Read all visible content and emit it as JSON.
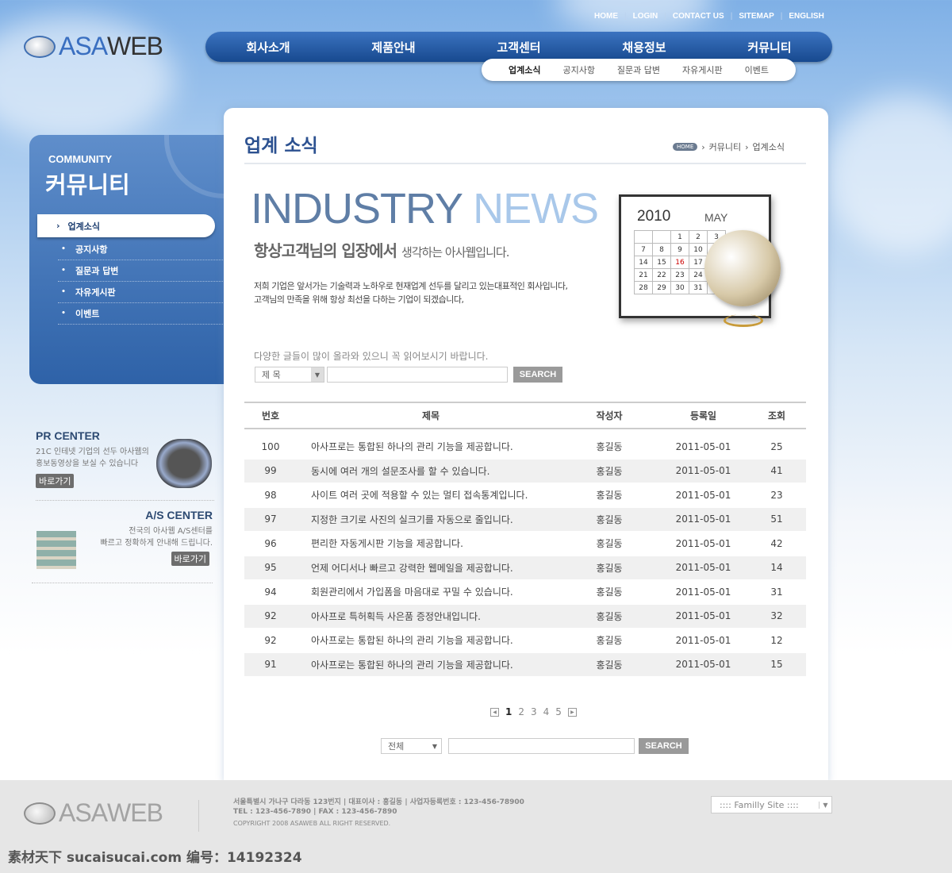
{
  "topnav": [
    "HOME",
    "LOGIN",
    "CONTACT US",
    "SITEMAP",
    "ENGLISH"
  ],
  "logo": {
    "text_a": "ASA",
    "text_b": "WEB"
  },
  "mainnav": [
    "회사소개",
    "제품안내",
    "고객센터",
    "채용정보",
    "커뮤니티"
  ],
  "subnav": [
    "업계소식",
    "공지사항",
    "질문과 답변",
    "자유게시판",
    "이벤트"
  ],
  "sidebar": {
    "title_en": "COMMUNITY",
    "title_ko": "커뮤니티",
    "active": "업계소식",
    "items": [
      "공지사항",
      "질문과 답변",
      "자유게시판",
      "이벤트"
    ]
  },
  "pr": {
    "title": "PR CENTER",
    "line1": "21C 인테넷 기업의 선두 아사웹의",
    "line2": "홍보동영상을 보실 수 있습니다",
    "button": "바로가기"
  },
  "as": {
    "title": "A/S CENTER",
    "line1": "전국의 아사웹 A/S센터를",
    "line2": "빠르고 정확하게 안내해 드립니다.",
    "button": "바로가기"
  },
  "page": {
    "title": "업계 소식",
    "breadcrumb": {
      "home": "HOME",
      "parent": "커뮤니티",
      "current": "업계소식"
    }
  },
  "banner": {
    "word1": "INDUSTRY",
    "word2": "NEWS",
    "slogan_bold": "항상고객님의 입장에서",
    "slogan_rest": "생각하는 아사웹입니다.",
    "desc1": "저희 기업은 앞서가는 기술력과 노하우로 현재업계 선두를 달리고 있는대표적인 회사입니다,",
    "desc2": "고객님의 만족을 위해 항상 최선을 다하는 기업이 되겠습니다,"
  },
  "calendar": {
    "year": "2010",
    "month": "MAY",
    "days": [
      [
        "",
        "",
        "1",
        "2",
        "3"
      ],
      [
        "7",
        "8",
        "9",
        "10",
        ""
      ],
      [
        "14",
        "15",
        "16",
        "17",
        ""
      ],
      [
        "21",
        "22",
        "23",
        "24",
        ""
      ],
      [
        "28",
        "29",
        "30",
        "31",
        ""
      ]
    ]
  },
  "search_top": {
    "hint": "다양한 글들이 많이 올라와 있으니 꼭 읽어보시기 바랍니다.",
    "select": "제 목",
    "button": "SEARCH"
  },
  "table": {
    "headers": [
      "번호",
      "제목",
      "작성자",
      "등록일",
      "조회"
    ],
    "rows": [
      [
        "100",
        "아사프로는 통합된 하나의 관리 기능을 제공합니다.",
        "홍길동",
        "2011-05-01",
        "25"
      ],
      [
        "99",
        "동시에 여러 개의 설문조사를 할 수 있습니다.",
        "홍길동",
        "2011-05-01",
        "41"
      ],
      [
        "98",
        "사이트 여러 곳에 적용할 수 있는 멀티 접속통계입니다.",
        "홍길동",
        "2011-05-01",
        "23"
      ],
      [
        "97",
        "지정한 크기로 사진의 실크기를 자동으로 줄입니다.",
        "홍길동",
        "2011-05-01",
        "51"
      ],
      [
        "96",
        "편리한 자동게시판 기능을 제공합니다.",
        "홍길동",
        "2011-05-01",
        "42"
      ],
      [
        "95",
        "언제 어디서나 빠르고 강력한 웹메일을 제공합니다.",
        "홍길동",
        "2011-05-01",
        "14"
      ],
      [
        "94",
        "회원관리에서 가입폼을 마음대로 꾸밀 수 있습니다.",
        "홍길동",
        "2011-05-01",
        "31"
      ],
      [
        "92",
        "아사프로 특허획득 사은품 증정안내입니다.",
        "홍길동",
        "2011-05-01",
        "32"
      ],
      [
        "92",
        "아사프로는 통합된 하나의 관리 기능을 제공합니다.",
        "홍길동",
        "2011-05-01",
        "12"
      ],
      [
        "91",
        "아사프로는 통합된 하나의 관리 기능을 제공합니다.",
        "홍길동",
        "2011-05-01",
        "15"
      ]
    ]
  },
  "pager": {
    "pages": [
      "1",
      "2",
      "3",
      "4",
      "5"
    ],
    "current": "1"
  },
  "search_bottom": {
    "select": "전체",
    "button": "SEARCH"
  },
  "footer": {
    "address": "서울특별시 가나구 다라동 123번지 | 대표이사 : 홍길동 | 사업자등록번호 : 123-456-78900",
    "tel": "TEL : 123-456-7890 | FAX : 123-456-7890",
    "copyright": "COPYRIGHT 2008 ASAWEB ALL RIGHT RESERVED.",
    "family_site": ":::: Familly Site ::::"
  },
  "watermark": "素材天下 sucaisucai.com  编号：14192324",
  "colors": {
    "nav": "#1f5199",
    "accent": "#2c5190",
    "footer": "#e6e6e6"
  }
}
